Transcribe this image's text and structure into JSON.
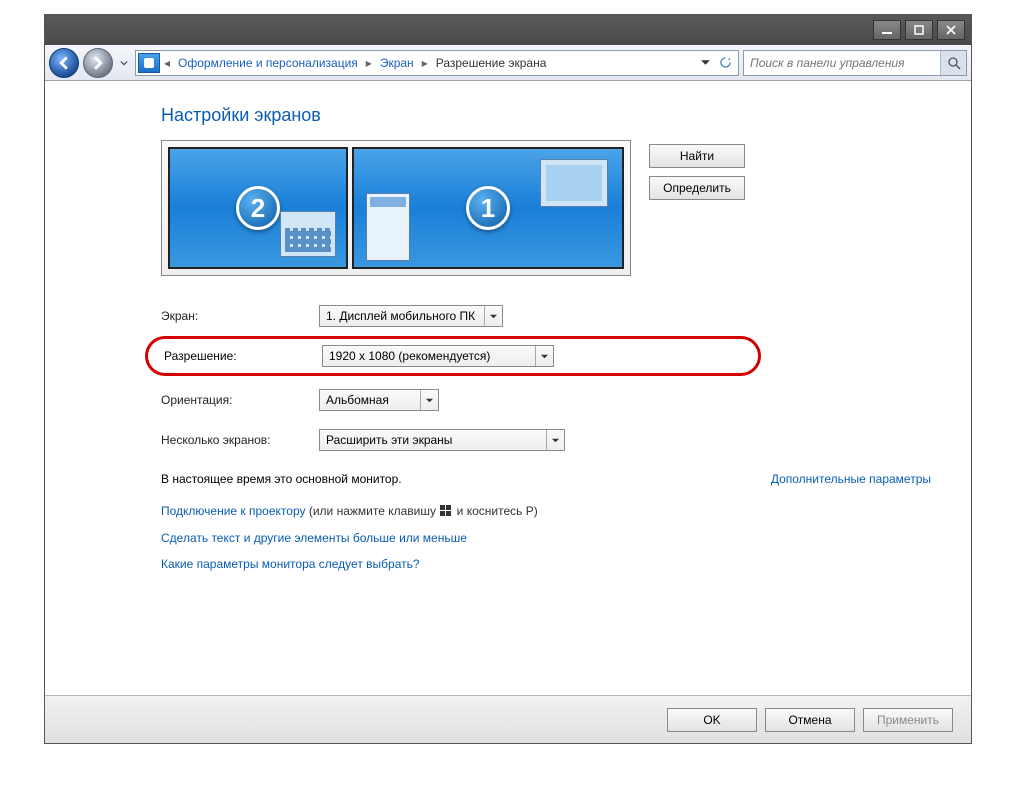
{
  "breadcrumb": {
    "item1": "Оформление и персонализация",
    "item2": "Экран",
    "item3": "Разрешение экрана"
  },
  "search": {
    "placeholder": "Поиск в панели управления"
  },
  "page_title": "Настройки экранов",
  "monitors": {
    "left_num": "2",
    "right_num": "1"
  },
  "buttons": {
    "find": "Найти",
    "identify": "Определить",
    "ok": "OK",
    "cancel": "Отмена",
    "apply": "Применить"
  },
  "form": {
    "display_label": "Экран:",
    "display_value": "1. Дисплей мобильного ПК",
    "resolution_label": "Разрешение:",
    "resolution_value": "1920 x 1080 (рекомендуется)",
    "orientation_label": "Ориентация:",
    "orientation_value": "Альбомная",
    "multi_label": "Несколько экранов:",
    "multi_value": "Расширить эти экраны"
  },
  "status": {
    "main_monitor": "В настоящее время это основной монитор.",
    "advanced": "Дополнительные параметры"
  },
  "links": {
    "projector_a": "Подключение к проектору",
    "projector_b": " (или нажмите клавишу ",
    "projector_c": " и коснитесь P)",
    "text_size": "Сделать текст и другие элементы больше или меньше",
    "which_params": "Какие параметры монитора следует выбрать?"
  }
}
